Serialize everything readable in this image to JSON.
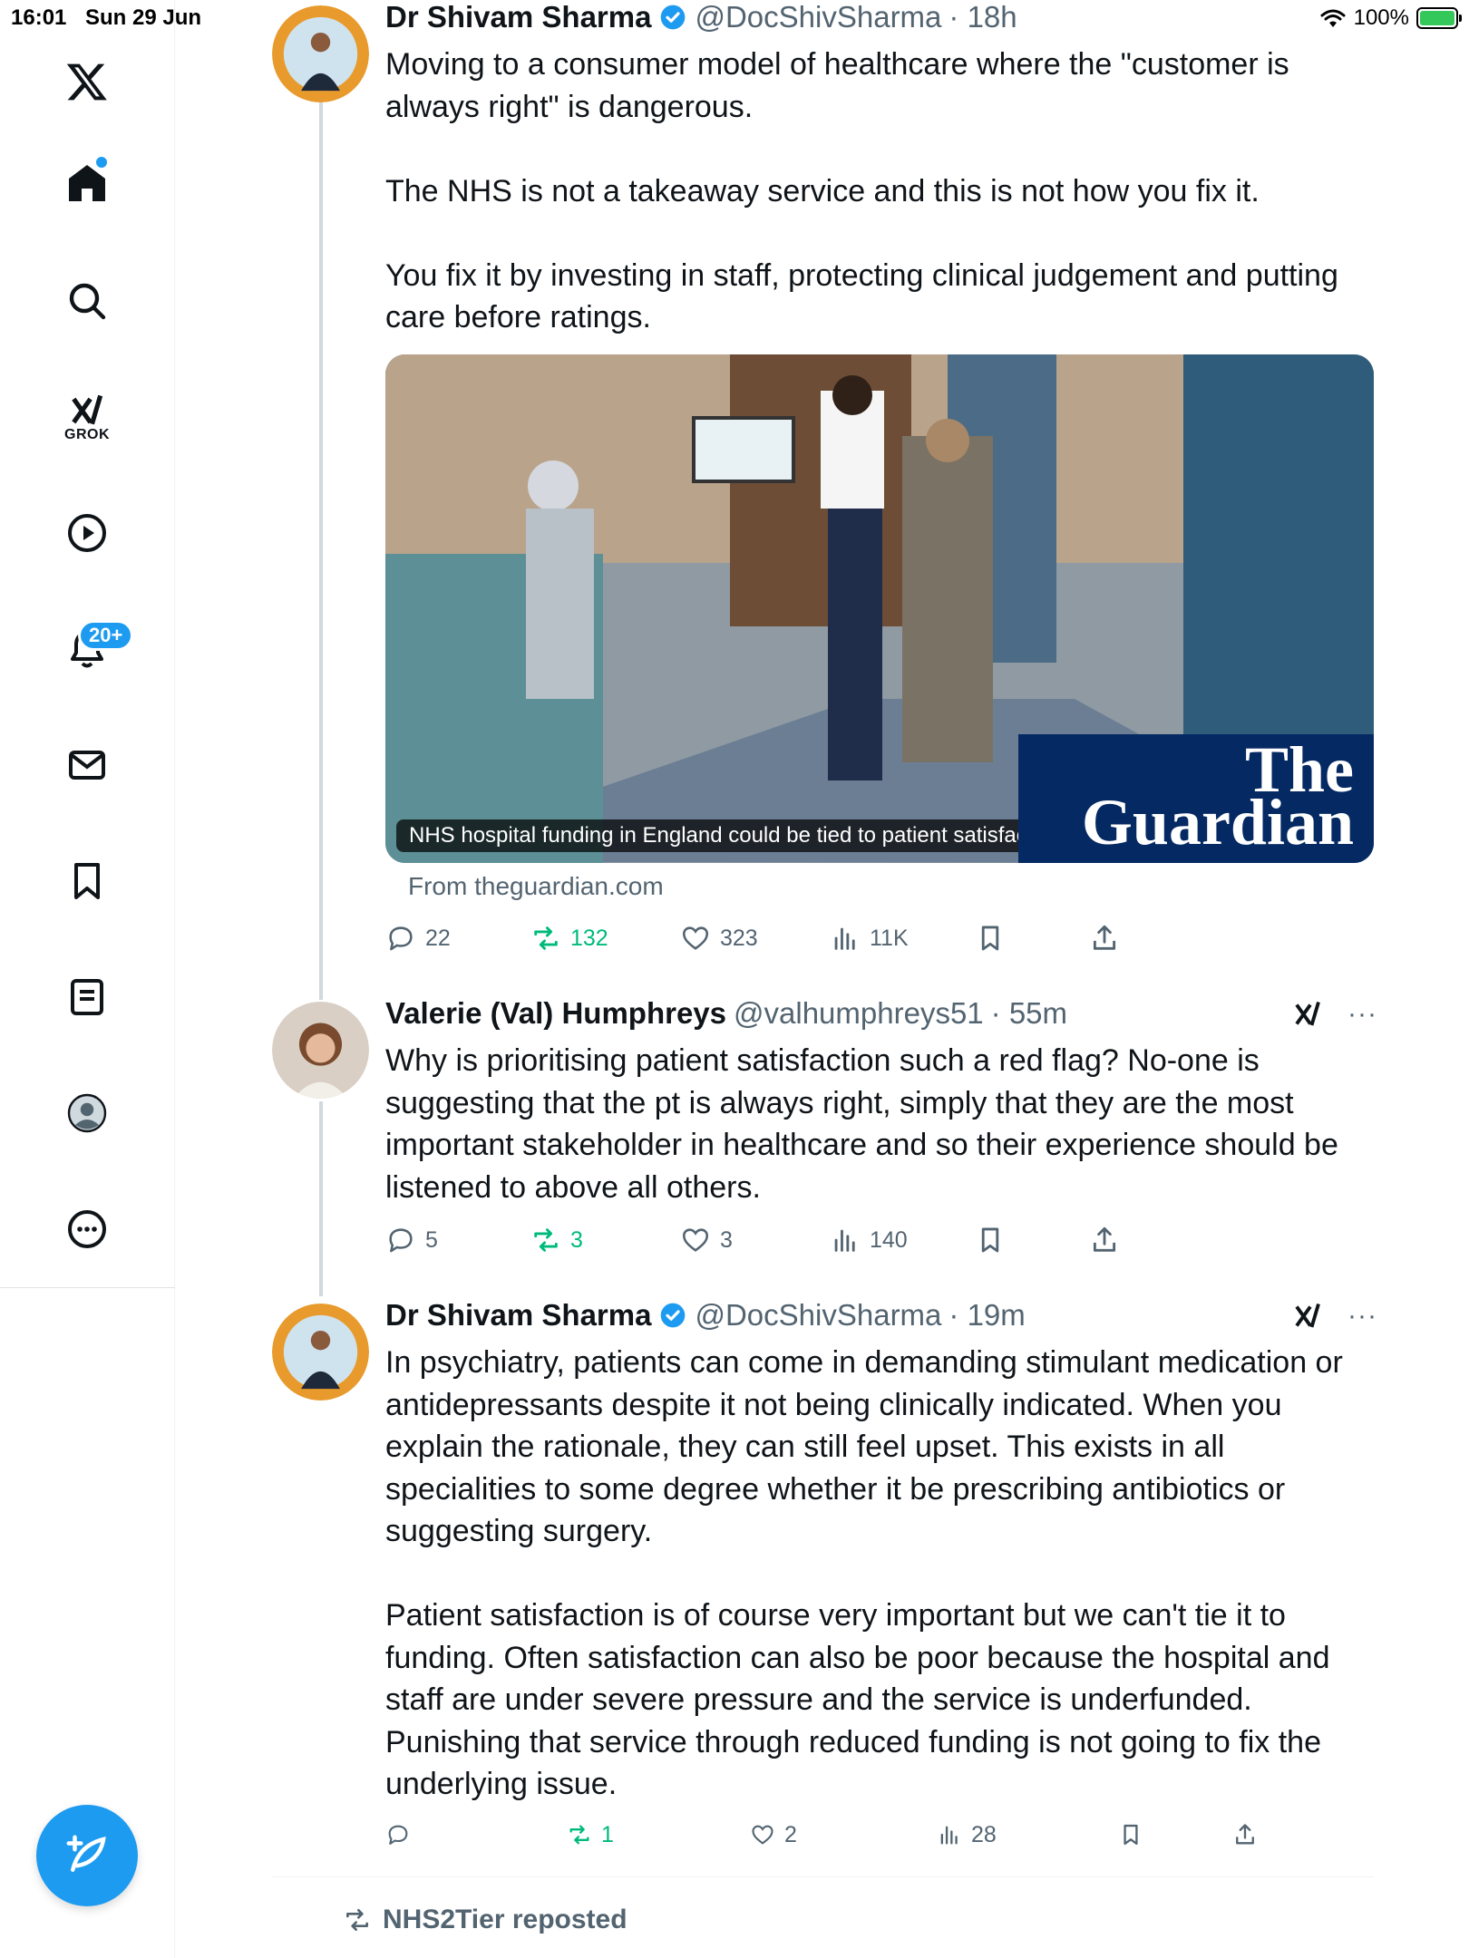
{
  "status_bar": {
    "time": "16:01",
    "date": "Sun 29 Jun",
    "battery": "100%"
  },
  "sidebar": {
    "items": [
      {
        "name": "home",
        "icon": "home-icon"
      },
      {
        "name": "search",
        "icon": "search-icon"
      },
      {
        "name": "grok",
        "icon": "grok-icon",
        "label": "GROK"
      },
      {
        "name": "videos",
        "icon": "play-icon"
      },
      {
        "name": "notifications",
        "icon": "bell-icon",
        "badge": "20+"
      },
      {
        "name": "messages",
        "icon": "mail-icon"
      },
      {
        "name": "bookmarks",
        "icon": "bookmark-icon"
      },
      {
        "name": "lists",
        "icon": "list-icon"
      },
      {
        "name": "profile",
        "icon": "profile-icon"
      },
      {
        "name": "more",
        "icon": "more-icon"
      }
    ],
    "accent": "#1d9bf0"
  },
  "tweets": [
    {
      "name": "Dr Shivam Sharma",
      "handle": "@DocShivSharma",
      "time": "· 18h",
      "verified": true,
      "text": "Moving to a consumer model of healthcare where the \"customer is always right\" is dangerous.\n\nThe NHS is not a takeaway service and this is not how you fix it.\n\nYou fix it by investing in staff, protecting clinical judgement and putting care before ratings.",
      "card": {
        "caption": "NHS hospital funding in England could be tied to patient satisfaction",
        "brand_line1": "The",
        "brand_line2": "Guardian",
        "source": "From theguardian.com"
      },
      "stats": {
        "replies": "22",
        "reposts": "132",
        "likes": "323",
        "views": "11K"
      }
    },
    {
      "name": "Valerie (Val) Humphreys",
      "handle": "@valhumphreys51",
      "time": "· 55m",
      "verified": false,
      "text": "Why is prioritising patient satisfaction such a red flag? No-one is suggesting that the pt is always right, simply that they are the most important stakeholder in healthcare and so their experience should be listened to above all others.",
      "stats": {
        "replies": "5",
        "reposts": "3",
        "likes": "3",
        "views": "140"
      }
    },
    {
      "name": "Dr Shivam Sharma",
      "handle": "@DocShivSharma",
      "time": "· 19m",
      "verified": true,
      "text": "In psychiatry, patients can come in demanding stimulant medication or antidepressants despite it not being clinically indicated. When you explain the rationale, they can still feel upset. This exists in all specialities to some degree whether it be prescribing antibiotics or suggesting surgery.\n\nPatient satisfaction is of course very important but we can't tie it to funding. Often satisfaction can also be poor because the hospital and staff are under severe pressure and the service is underfunded. Punishing that service through reduced funding is not going to fix the underlying issue.",
      "stats": {
        "replies": "",
        "reposts": "1",
        "likes": "2",
        "views": "28"
      }
    }
  ],
  "repost_banner": "NHS2Tier reposted",
  "colors": {
    "repost_green": "#00ba7c",
    "muted": "#536471",
    "guardian_blue": "#052962"
  }
}
